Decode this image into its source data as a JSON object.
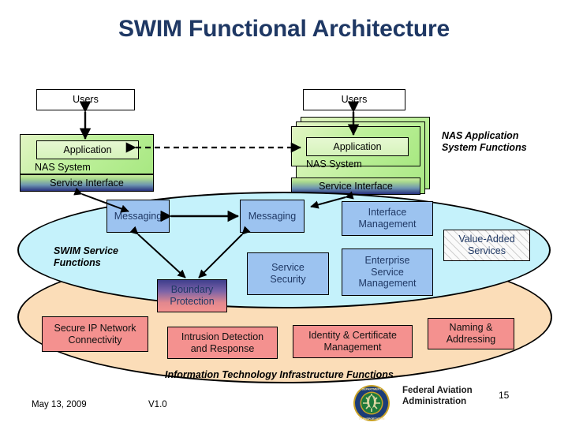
{
  "slide": {
    "title": "SWIM Functional Architecture",
    "page_number": "15"
  },
  "nas_left": {
    "users_label": "Users",
    "application_label": "Application",
    "system_label": "NAS System",
    "service_interface_label": "Service Interface"
  },
  "nas_right": {
    "users_label": "Users",
    "application_label": "Application",
    "system_label": "NAS System",
    "service_interface_label": "Service Interface"
  },
  "labels": {
    "nas_app_system_functions": "NAS Application\nSystem Functions",
    "nas_app_system_functions_line1": "NAS Application",
    "nas_app_system_functions_line2": "System Functions",
    "swim_service_functions_line1": "SWIM Service",
    "swim_service_functions_line2": "Functions",
    "it_infrastructure_functions": "Information Technology Infrastructure Functions"
  },
  "swim_boxes": {
    "messaging_left": "Messaging",
    "messaging_right": "Messaging",
    "interface_management_line1": "Interface",
    "interface_management_line2": "Management",
    "value_added_line1": "Value-Added",
    "value_added_line2": "Services",
    "service_security_line1": "Service",
    "service_security_line2": "Security",
    "enterprise_service_mgmt_line1": "Enterprise",
    "enterprise_service_mgmt_line2": "Service",
    "enterprise_service_mgmt_line3": "Management",
    "boundary_protection_line1": "Boundary",
    "boundary_protection_line2": "Protection"
  },
  "it_boxes": {
    "secure_ip_line1": "Secure IP Network",
    "secure_ip_line2": "Connectivity",
    "intrusion_line1": "Intrusion Detection",
    "intrusion_line2": "and Response",
    "identity_line1": "Identity & Certificate",
    "identity_line2": "Management",
    "naming_line1": "Naming &",
    "naming_line2": "Addressing"
  },
  "footer": {
    "date": "May 13, 2009",
    "version": "V1.0",
    "agency_line1": "Federal Aviation",
    "agency_line2": "Administration",
    "page": "15",
    "seal_icon": "faa-seal-icon"
  },
  "colors": {
    "title": "#1F3864",
    "swim_ellipse": "#C5F2FB",
    "it_ellipse": "#FBDDB8",
    "nas_green": "#BDF09A",
    "mid_blue": "#9CC3F0",
    "bottom_salmon": "#F4918F"
  }
}
